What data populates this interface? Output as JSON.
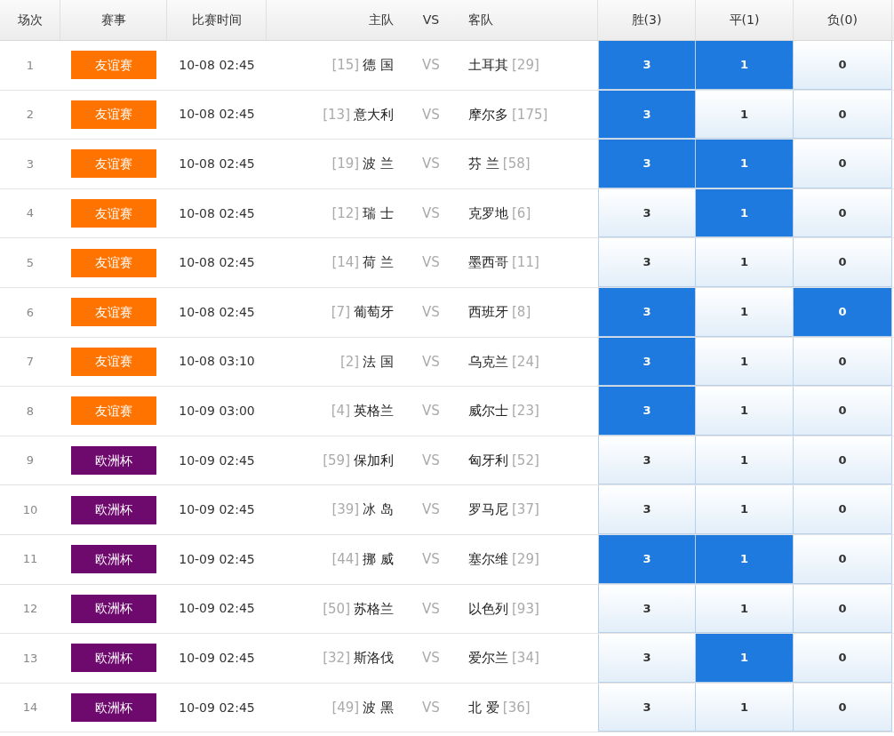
{
  "header": [
    "场次",
    "赛事",
    "比赛时间",
    "主队",
    "VS",
    "客队",
    "胜(3)",
    "平(1)",
    "负(0)"
  ],
  "rows": [
    {
      "num": "1",
      "league": {
        "name": "友谊赛",
        "color": "#ff7300"
      },
      "time": "10-08 02:45",
      "home_rank": "[15]",
      "home": "德 国",
      "vs": "VS",
      "away": "土耳其",
      "away_rank": "[29]",
      "options": [
        {
          "label": "3",
          "selected": true
        },
        {
          "label": "1",
          "selected": true
        },
        {
          "label": "0",
          "selected": false
        }
      ]
    },
    {
      "num": "2",
      "league": {
        "name": "友谊赛",
        "color": "#ff7300"
      },
      "time": "10-08 02:45",
      "home_rank": "[13]",
      "home": "意大利",
      "vs": "VS",
      "away": "摩尔多",
      "away_rank": "[175]",
      "options": [
        {
          "label": "3",
          "selected": true
        },
        {
          "label": "1",
          "selected": false
        },
        {
          "label": "0",
          "selected": false
        }
      ]
    },
    {
      "num": "3",
      "league": {
        "name": "友谊赛",
        "color": "#ff7300"
      },
      "time": "10-08 02:45",
      "home_rank": "[19]",
      "home": "波 兰",
      "vs": "VS",
      "away": "芬 兰",
      "away_rank": "[58]",
      "options": [
        {
          "label": "3",
          "selected": true
        },
        {
          "label": "1",
          "selected": true
        },
        {
          "label": "0",
          "selected": false
        }
      ]
    },
    {
      "num": "4",
      "league": {
        "name": "友谊赛",
        "color": "#ff7300"
      },
      "time": "10-08 02:45",
      "home_rank": "[12]",
      "home": "瑞 士",
      "vs": "VS",
      "away": "克罗地",
      "away_rank": "[6]",
      "options": [
        {
          "label": "3",
          "selected": false
        },
        {
          "label": "1",
          "selected": true
        },
        {
          "label": "0",
          "selected": false
        }
      ]
    },
    {
      "num": "5",
      "league": {
        "name": "友谊赛",
        "color": "#ff7300"
      },
      "time": "10-08 02:45",
      "home_rank": "[14]",
      "home": "荷 兰",
      "vs": "VS",
      "away": "墨西哥",
      "away_rank": "[11]",
      "options": [
        {
          "label": "3",
          "selected": false
        },
        {
          "label": "1",
          "selected": false
        },
        {
          "label": "0",
          "selected": false
        }
      ]
    },
    {
      "num": "6",
      "league": {
        "name": "友谊赛",
        "color": "#ff7300"
      },
      "time": "10-08 02:45",
      "home_rank": "[7]",
      "home": "葡萄牙",
      "vs": "VS",
      "away": "西班牙",
      "away_rank": "[8]",
      "options": [
        {
          "label": "3",
          "selected": true
        },
        {
          "label": "1",
          "selected": false
        },
        {
          "label": "0",
          "selected": true
        }
      ]
    },
    {
      "num": "7",
      "league": {
        "name": "友谊赛",
        "color": "#ff7300"
      },
      "time": "10-08 03:10",
      "home_rank": "[2]",
      "home": "法 国",
      "vs": "VS",
      "away": "乌克兰",
      "away_rank": "[24]",
      "options": [
        {
          "label": "3",
          "selected": true
        },
        {
          "label": "1",
          "selected": false
        },
        {
          "label": "0",
          "selected": false
        }
      ]
    },
    {
      "num": "8",
      "league": {
        "name": "友谊赛",
        "color": "#ff7300"
      },
      "time": "10-09 03:00",
      "home_rank": "[4]",
      "home": "英格兰",
      "vs": "VS",
      "away": "威尔士",
      "away_rank": "[23]",
      "options": [
        {
          "label": "3",
          "selected": true
        },
        {
          "label": "1",
          "selected": false
        },
        {
          "label": "0",
          "selected": false
        }
      ]
    },
    {
      "num": "9",
      "league": {
        "name": "欧洲杯",
        "color": "#6e0a6e"
      },
      "time": "10-09 02:45",
      "home_rank": "[59]",
      "home": "保加利",
      "vs": "VS",
      "away": "匈牙利",
      "away_rank": "[52]",
      "options": [
        {
          "label": "3",
          "selected": false
        },
        {
          "label": "1",
          "selected": false
        },
        {
          "label": "0",
          "selected": false
        }
      ]
    },
    {
      "num": "10",
      "league": {
        "name": "欧洲杯",
        "color": "#6e0a6e"
      },
      "time": "10-09 02:45",
      "home_rank": "[39]",
      "home": "冰 岛",
      "vs": "VS",
      "away": "罗马尼",
      "away_rank": "[37]",
      "options": [
        {
          "label": "3",
          "selected": false
        },
        {
          "label": "1",
          "selected": false
        },
        {
          "label": "0",
          "selected": false
        }
      ]
    },
    {
      "num": "11",
      "league": {
        "name": "欧洲杯",
        "color": "#6e0a6e"
      },
      "time": "10-09 02:45",
      "home_rank": "[44]",
      "home": "挪 威",
      "vs": "VS",
      "away": "塞尔维",
      "away_rank": "[29]",
      "options": [
        {
          "label": "3",
          "selected": true
        },
        {
          "label": "1",
          "selected": true
        },
        {
          "label": "0",
          "selected": false
        }
      ]
    },
    {
      "num": "12",
      "league": {
        "name": "欧洲杯",
        "color": "#6e0a6e"
      },
      "time": "10-09 02:45",
      "home_rank": "[50]",
      "home": "苏格兰",
      "vs": "VS",
      "away": "以色列",
      "away_rank": "[93]",
      "options": [
        {
          "label": "3",
          "selected": false
        },
        {
          "label": "1",
          "selected": false
        },
        {
          "label": "0",
          "selected": false
        }
      ]
    },
    {
      "num": "13",
      "league": {
        "name": "欧洲杯",
        "color": "#6e0a6e"
      },
      "time": "10-09 02:45",
      "home_rank": "[32]",
      "home": "斯洛伐",
      "vs": "VS",
      "away": "爱尔兰",
      "away_rank": "[34]",
      "options": [
        {
          "label": "3",
          "selected": false
        },
        {
          "label": "1",
          "selected": true
        },
        {
          "label": "0",
          "selected": false
        }
      ]
    },
    {
      "num": "14",
      "league": {
        "name": "欧洲杯",
        "color": "#6e0a6e"
      },
      "time": "10-09 02:45",
      "home_rank": "[49]",
      "home": "波 黑",
      "vs": "VS",
      "away": "北 爱",
      "away_rank": "[36]",
      "options": [
        {
          "label": "3",
          "selected": false
        },
        {
          "label": "1",
          "selected": false
        },
        {
          "label": "0",
          "selected": false
        }
      ]
    }
  ]
}
